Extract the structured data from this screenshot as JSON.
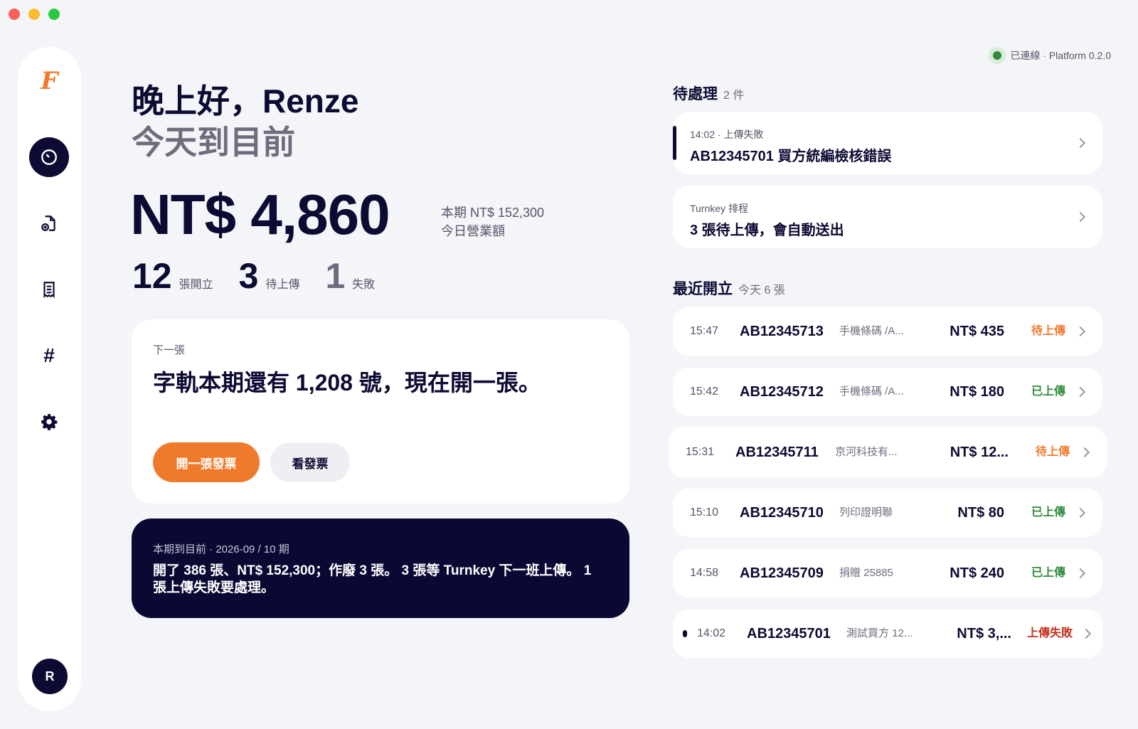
{
  "window": {
    "controls": [
      "close",
      "minimize",
      "zoom"
    ]
  },
  "sidebar": {
    "logo": "F",
    "items": [
      {
        "name": "dashboard",
        "icon": "clock-icon",
        "active": true
      },
      {
        "name": "new-invoice",
        "icon": "document-add-icon",
        "active": false
      },
      {
        "name": "invoices",
        "icon": "receipt-icon",
        "active": false
      },
      {
        "name": "number-track",
        "icon": "hash-icon",
        "active": false
      },
      {
        "name": "settings",
        "icon": "gear-icon",
        "active": false
      }
    ],
    "avatar": "R"
  },
  "connection": {
    "text": "已連線 · Platform 0.2.0",
    "color": "#2e8a3c"
  },
  "greeting": {
    "title": "晚上好，Renze",
    "subtitle": "今天到目前"
  },
  "revenue": {
    "amount": "NT$ 4,860",
    "period_total": "本期 NT$ 152,300",
    "label": "今日營業額"
  },
  "stats": [
    {
      "value": "12",
      "label": "張開立",
      "muted": false
    },
    {
      "value": "3",
      "label": "待上傳",
      "muted": false
    },
    {
      "value": "1",
      "label": "失敗",
      "muted": true
    }
  ],
  "next": {
    "caption": "下一張",
    "headline": "字軌本期還有 1,208 號，現在開一張。",
    "primary_button": "開一張發票",
    "secondary_button": "看發票"
  },
  "period": {
    "caption": "本期到目前 · 2026-09 / 10 期",
    "summary": "開了 386 張、NT$ 152,300；作廢 3 張。 3 張等 Turnkey 下一班上傳。 1 張上傳失敗要處理。"
  },
  "pending": {
    "title": "待處理",
    "count": "2 件",
    "items": [
      {
        "caption": "14:02 · 上傳失敗",
        "title": "AB12345701 買方統編檢核錯誤",
        "marked": true
      },
      {
        "caption": "Turnkey 排程",
        "title": "3 張待上傳，會自動送出",
        "marked": false
      }
    ]
  },
  "recent": {
    "title": "最近開立",
    "count": "今天 6 張",
    "rows": [
      {
        "time": "15:47",
        "number": "AB12345713",
        "desc": "手機條碼 /A...",
        "amount": "NT$ 435",
        "status": "待上傳",
        "status_type": "pending"
      },
      {
        "time": "15:42",
        "number": "AB12345712",
        "desc": "手機條碼 /A...",
        "amount": "NT$ 180",
        "status": "已上傳",
        "status_type": "done"
      },
      {
        "time": "15:31",
        "number": "AB12345711",
        "desc": "京河科技有...",
        "amount": "NT$ 12...",
        "status": "待上傳",
        "status_type": "pending"
      },
      {
        "time": "15:10",
        "number": "AB12345710",
        "desc": "列印證明聯",
        "amount": "NT$ 80",
        "status": "已上傳",
        "status_type": "done"
      },
      {
        "time": "14:58",
        "number": "AB12345709",
        "desc": "捐贈 25885",
        "amount": "NT$ 240",
        "status": "已上傳",
        "status_type": "done"
      },
      {
        "time": "14:02",
        "number": "AB12345701",
        "desc": "測試買方 12...",
        "amount": "NT$ 3,...",
        "status": "上傳失敗",
        "status_type": "fail"
      }
    ]
  },
  "colors": {
    "accent": "#f07a2c",
    "navy": "#0d0a33",
    "success": "#2e8a3c",
    "error": "#c2321f"
  }
}
